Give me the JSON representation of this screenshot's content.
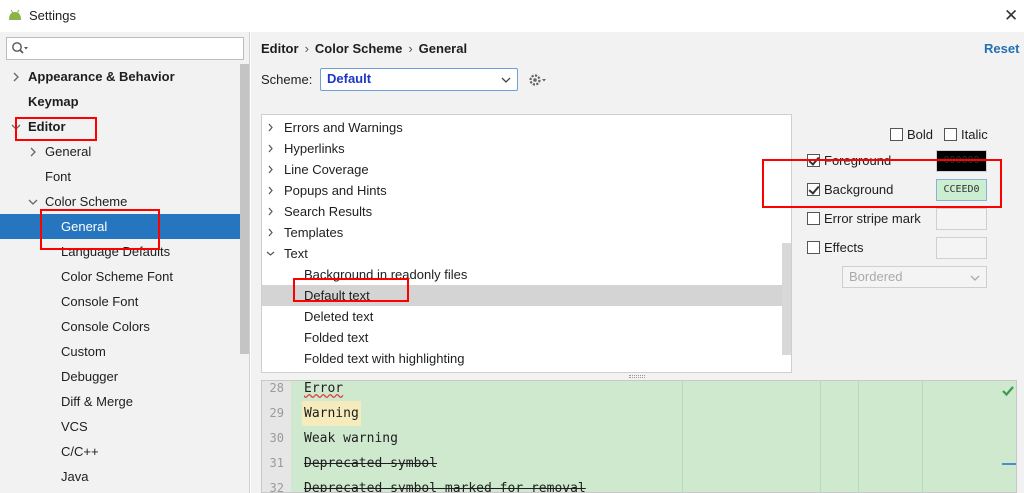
{
  "window": {
    "title": "Settings",
    "close_icon": "close-icon"
  },
  "search": {
    "placeholder": "",
    "value": ""
  },
  "sidebar": {
    "items": [
      {
        "label": "Appearance & Behavior",
        "bold": true,
        "arrow": "collapsed"
      },
      {
        "label": "Keymap",
        "bold": true,
        "arrow": "none"
      },
      {
        "label": "Editor",
        "bold": true,
        "arrow": "expanded"
      },
      {
        "label": "General",
        "arrow": "collapsed"
      },
      {
        "label": "Font",
        "arrow": "none"
      },
      {
        "label": "Color Scheme",
        "arrow": "expanded"
      },
      {
        "label": "General",
        "selected": true
      },
      {
        "label": "Language Defaults"
      },
      {
        "label": "Color Scheme Font"
      },
      {
        "label": "Console Font"
      },
      {
        "label": "Console Colors"
      },
      {
        "label": "Custom"
      },
      {
        "label": "Debugger"
      },
      {
        "label": "Diff & Merge"
      },
      {
        "label": "VCS"
      },
      {
        "label": "C/C++"
      },
      {
        "label": "Java"
      }
    ]
  },
  "breadcrumb": {
    "items": [
      "Editor",
      "Color Scheme",
      "General"
    ]
  },
  "reset_label": "Reset",
  "scheme": {
    "label": "Scheme:",
    "value": "Default"
  },
  "elements": [
    {
      "label": "Errors and Warnings",
      "expandable": true
    },
    {
      "label": "Hyperlinks",
      "expandable": true
    },
    {
      "label": "Line Coverage",
      "expandable": true
    },
    {
      "label": "Popups and Hints",
      "expandable": true
    },
    {
      "label": "Search Results",
      "expandable": true
    },
    {
      "label": "Templates",
      "expandable": true
    },
    {
      "label": "Text",
      "expanded": true
    },
    {
      "label": "Background in readonly files",
      "child": true
    },
    {
      "label": "Default text",
      "child": true,
      "selected": true
    },
    {
      "label": "Deleted text",
      "child": true
    },
    {
      "label": "Folded text",
      "child": true
    },
    {
      "label": "Folded text with highlighting",
      "child": true
    }
  ],
  "attributes": {
    "bold_label": "Bold",
    "bold_checked": false,
    "italic_label": "Italic",
    "italic_checked": false,
    "foreground_label": "Foreground",
    "foreground_checked": true,
    "foreground_value": "000000",
    "background_label": "Background",
    "background_checked": true,
    "background_value": "CCEED0",
    "error_stripe_label": "Error stripe mark",
    "error_stripe_checked": false,
    "effects_label": "Effects",
    "effects_checked": false,
    "effect_type": "Bordered"
  },
  "preview": {
    "lines": [
      {
        "num": "28",
        "text": "Error",
        "style": "err"
      },
      {
        "num": "29",
        "text": "Warning",
        "style": "warn"
      },
      {
        "num": "30",
        "text": "Weak warning",
        "style": ""
      },
      {
        "num": "31",
        "text": "Deprecated symbol",
        "style": "strike"
      },
      {
        "num": "32",
        "text": "Deprecated symbol marked for removal",
        "style": "strike"
      }
    ]
  },
  "colors": {
    "selection": "#2675bf",
    "preview_bg": "#cfe9cf",
    "accent_link": "#2470b3",
    "annotation": "#ff0000",
    "foreground_swatch": "#000000",
    "background_swatch": "#cceed0"
  }
}
